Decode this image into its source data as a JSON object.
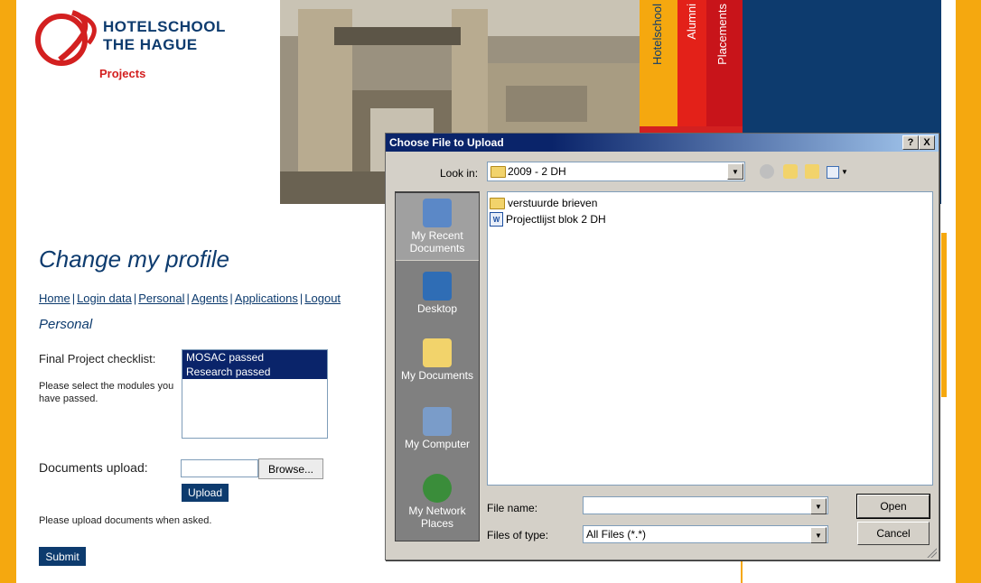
{
  "brand": {
    "line1": "HOTELSCHOOL",
    "line2": "THE HAGUE",
    "sub": "Projects",
    "primary_color": "#0d3b6e",
    "accent_color": "#f5a80f",
    "red_color": "#d32020"
  },
  "tabs": [
    {
      "label": "Hotelschool"
    },
    {
      "label": "Alumni"
    },
    {
      "label": "Placements"
    }
  ],
  "page": {
    "title": "Change my profile",
    "section": "Personal",
    "nav": [
      "Home",
      "Login data",
      "Personal",
      "Agents",
      "Applications",
      "Logout"
    ]
  },
  "form": {
    "checklist_label": "Final Project checklist:",
    "checklist_help": "Please select the modules you have passed.",
    "checklist_items": [
      "MOSAC passed",
      "Research passed"
    ],
    "upload_label": "Documents upload:",
    "browse_label": "Browse...",
    "upload_button": "Upload",
    "upload_note": "Please upload documents when asked.",
    "submit_button": "Submit"
  },
  "dialog": {
    "title": "Choose File to Upload",
    "help_label": "?",
    "close_label": "X",
    "look_in_label": "Look in:",
    "look_in_value": "2009 - 2 DH",
    "places": [
      "My Recent Documents",
      "Desktop",
      "My Documents",
      "My Computer",
      "My Network Places"
    ],
    "files": [
      {
        "name": "verstuurde brieven",
        "type": "folder"
      },
      {
        "name": "Projectlijst blok 2 DH",
        "type": "word"
      }
    ],
    "file_name_label": "File name:",
    "file_name_value": "",
    "files_of_type_label": "Files of type:",
    "files_of_type_value": "All Files (*.*)",
    "open_button": "Open",
    "cancel_button": "Cancel"
  }
}
